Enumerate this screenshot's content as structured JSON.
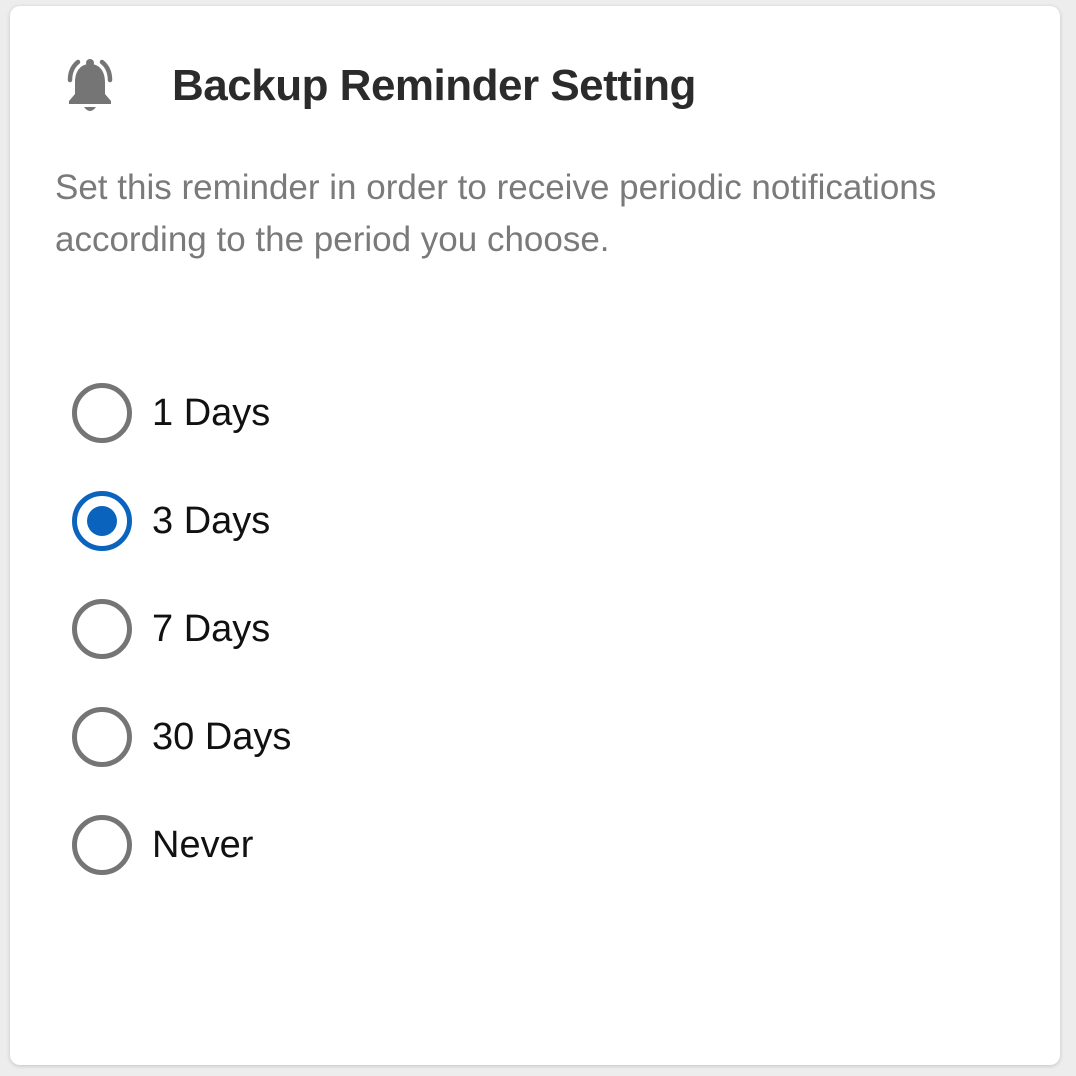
{
  "dialog": {
    "title": "Backup Reminder Setting",
    "icon": "bell-ringing-icon",
    "description": "Set this reminder in order to receive periodic notifications according to the period you choose."
  },
  "options": [
    {
      "label": "1 Days",
      "selected": false
    },
    {
      "label": "3 Days",
      "selected": true
    },
    {
      "label": "7 Days",
      "selected": false
    },
    {
      "label": "30 Days",
      "selected": false
    },
    {
      "label": "Never",
      "selected": false
    }
  ],
  "colors": {
    "accent": "#0a64bd",
    "radio_unselected": "#757575",
    "icon": "#757575",
    "title": "#2b2b2b",
    "description": "#7a7a7a"
  }
}
